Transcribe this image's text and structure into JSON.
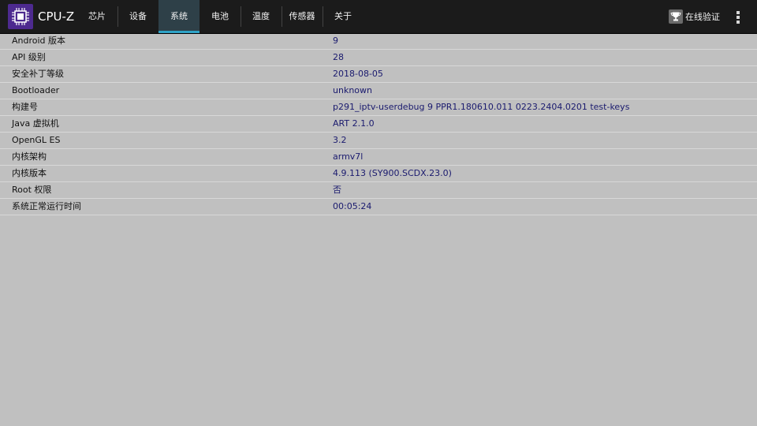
{
  "app": {
    "title": "CPU-Z",
    "logo_icon": "cpu-chip-icon"
  },
  "tabs": [
    {
      "label": "芯片",
      "active": false
    },
    {
      "label": "设备",
      "active": false
    },
    {
      "label": "系统",
      "active": true
    },
    {
      "label": "电池",
      "active": false
    },
    {
      "label": "温度",
      "active": false
    },
    {
      "label": "传感器",
      "active": false
    },
    {
      "label": "关于",
      "active": false
    }
  ],
  "toolbar": {
    "validate_label": "在线验证",
    "validate_icon": "trophy-icon",
    "menu_icon": "overflow-menu-icon"
  },
  "system_info": {
    "rows": [
      {
        "label": "Android 版本",
        "value": "9"
      },
      {
        "label": "API 级别",
        "value": "28"
      },
      {
        "label": "安全补丁等级",
        "value": "2018-08-05"
      },
      {
        "label": "Bootloader",
        "value": "unknown"
      },
      {
        "label": "构建号",
        "value": "p291_iptv-userdebug 9 PPR1.180610.011 0223.2404.0201 test-keys"
      },
      {
        "label": "Java 虚拟机",
        "value": "ART 2.1.0"
      },
      {
        "label": "OpenGL ES",
        "value": "3.2"
      },
      {
        "label": "内核架构",
        "value": "armv7l"
      },
      {
        "label": "内核版本",
        "value": "4.9.113 (SY900.SCDX.23.0)"
      },
      {
        "label": "Root 权限",
        "value": "否"
      },
      {
        "label": "系统正常运行时间",
        "value": "00:05:24"
      }
    ]
  },
  "colors": {
    "topbar": "#1b1b1b",
    "active_tab_indicator": "#2fa3c7",
    "background": "#c0c0c0",
    "value_text": "#1a1a6e",
    "logo_bg": "#4d2a8f"
  }
}
